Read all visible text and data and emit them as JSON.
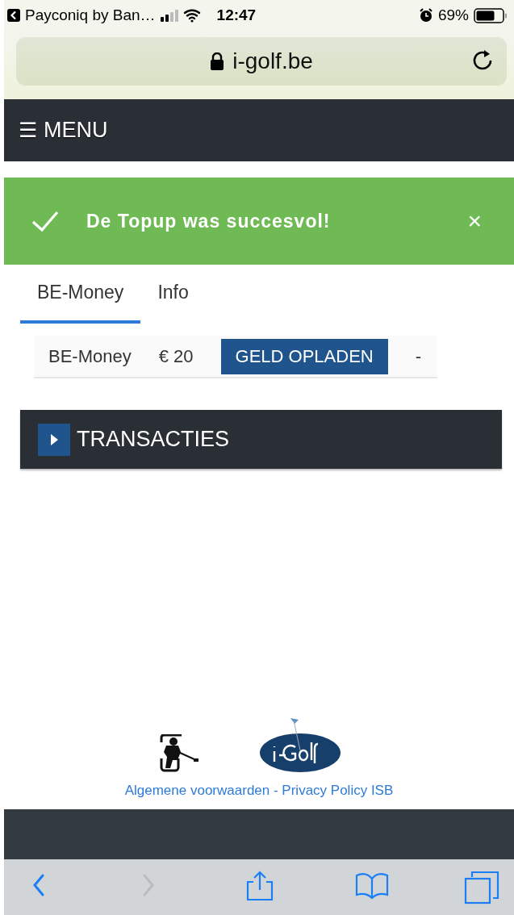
{
  "status_bar": {
    "back_app": "Payconiq by Ban…",
    "time": "12:47",
    "battery": "69%"
  },
  "address_bar": {
    "url": "i-golf.be"
  },
  "menu": {
    "icon": "☰",
    "label": "MENU"
  },
  "alert": {
    "message": "De Topup was succesvol!",
    "close": "×"
  },
  "tabs": [
    {
      "label": "BE-Money",
      "selected": true
    },
    {
      "label": "Info",
      "selected": false
    }
  ],
  "wallet": {
    "name": "BE-Money",
    "amount": "€ 20",
    "button": "GELD OPLADEN",
    "column_4": "-"
  },
  "section": {
    "title": "TRANSACTIES",
    "expanded": false
  },
  "footer": {
    "links": [
      {
        "label": "Algemene voorwaarden"
      },
      {
        "label": "Privacy Policy ISB"
      }
    ],
    "separator": "-"
  },
  "toolbar": [
    {
      "kind": "back",
      "disabled": false
    },
    {
      "kind": "forward",
      "disabled": true
    },
    {
      "kind": "share",
      "disabled": false
    },
    {
      "kind": "bookmarks",
      "disabled": false
    },
    {
      "kind": "tabs",
      "disabled": false
    }
  ]
}
